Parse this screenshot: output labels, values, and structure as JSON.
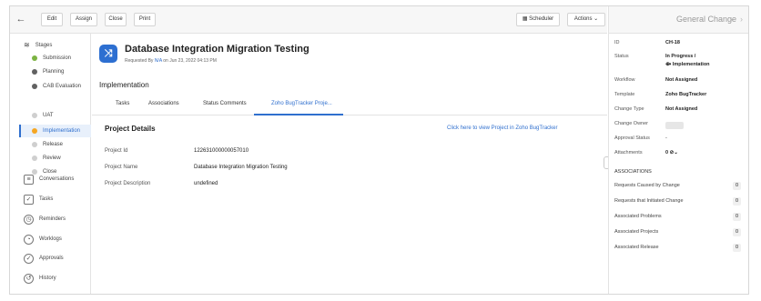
{
  "toolbar": {
    "edit_label": "Edit",
    "assign_label": "Assign",
    "close_label": "Close",
    "print_label": "Print",
    "scheduler_label": "Scheduler",
    "actions_label": "Actions ⌄"
  },
  "sidebar": {
    "stages_label": "Stages",
    "stages": [
      {
        "label": "Submission",
        "color": "#7cb342"
      },
      {
        "label": "Planning",
        "color": "#616161"
      },
      {
        "label": "CAB Evaluation",
        "color": "#616161"
      },
      {
        "label": "Implementation",
        "color": "#f5a623"
      },
      {
        "label": "UAT",
        "color": "#cfcfcf"
      },
      {
        "label": "Release",
        "color": "#cfcfcf"
      },
      {
        "label": "Review",
        "color": "#cfcfcf"
      },
      {
        "label": "Close",
        "color": "#cfcfcf"
      }
    ],
    "items": [
      {
        "label": "Conversations",
        "icon": "chat-icon"
      },
      {
        "label": "Tasks",
        "icon": "tasks-icon"
      },
      {
        "label": "Reminders",
        "icon": "alarm-icon"
      },
      {
        "label": "Worklogs",
        "icon": "timer-icon"
      },
      {
        "label": "Approvals",
        "icon": "check-circle-icon"
      },
      {
        "label": "History",
        "icon": "history-icon"
      }
    ]
  },
  "main": {
    "title": "Database Integration Migration Testing",
    "requested_by_prefix": "Requested By",
    "requested_by": "N/A",
    "requested_on": "on Jun 23, 2022 04:13 PM",
    "section_title": "Implementation",
    "tabs": [
      "Tasks",
      "Associations",
      "Status Comments",
      "Zoho BugTracker Proje..."
    ],
    "project_details_title": "Project Details",
    "project_link": "Click here to view Project in Zoho BugTracker",
    "fields": [
      {
        "label": "Project Id",
        "value": "122631000000057010"
      },
      {
        "label": "Project Name",
        "value": "Database Integration Migration Testing"
      },
      {
        "label": "Project Description",
        "value": "undefined"
      }
    ]
  },
  "right_panel": {
    "title": "General Change",
    "details": [
      {
        "label": "ID",
        "value": "CH-18"
      },
      {
        "label": "Status",
        "value": "In Progress /"
      },
      {
        "label": "",
        "value": "⟴ Implementation"
      },
      {
        "label": "Workflow",
        "value": "Not Assigned"
      },
      {
        "label": "Template",
        "value": "Zoho BugTracker"
      },
      {
        "label": "Change Type",
        "value": "Not Assigned"
      },
      {
        "label": "Change Owner",
        "value": ""
      },
      {
        "label": "Approval Status",
        "value": "-"
      },
      {
        "label": "Attachments",
        "value": "0  ⊘⌄"
      }
    ],
    "associations_heading": "ASSOCIATIONS",
    "associations": [
      {
        "label": "Requests Caused by Change",
        "count": "0"
      },
      {
        "label": "Requests that Initiated Change",
        "count": "0"
      },
      {
        "label": "Associated Problems",
        "count": "0"
      },
      {
        "label": "Associated Projects",
        "count": "0"
      },
      {
        "label": "Associated Release",
        "count": "0"
      }
    ]
  }
}
